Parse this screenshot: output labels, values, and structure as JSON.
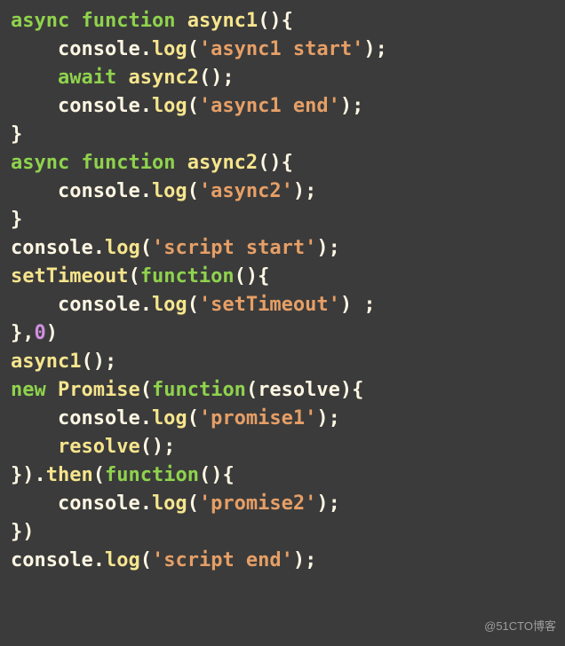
{
  "code": {
    "lines": [
      [
        {
          "cls": "tok-kw",
          "t": "async"
        },
        {
          "cls": "tok-punct",
          "t": " "
        },
        {
          "cls": "tok-kw",
          "t": "function"
        },
        {
          "cls": "tok-punct",
          "t": " "
        },
        {
          "cls": "tok-fn",
          "t": "async1"
        },
        {
          "cls": "tok-punct",
          "t": "(){"
        }
      ],
      [
        {
          "cls": "indent",
          "t": ""
        },
        {
          "cls": "tok-ident",
          "t": "console"
        },
        {
          "cls": "tok-punct",
          "t": "."
        },
        {
          "cls": "tok-fn",
          "t": "log"
        },
        {
          "cls": "tok-punct",
          "t": "("
        },
        {
          "cls": "tok-str",
          "t": "'async1 start'"
        },
        {
          "cls": "tok-punct",
          "t": ");"
        }
      ],
      [
        {
          "cls": "indent",
          "t": ""
        },
        {
          "cls": "tok-kw",
          "t": "await"
        },
        {
          "cls": "tok-punct",
          "t": " "
        },
        {
          "cls": "tok-fn",
          "t": "async2"
        },
        {
          "cls": "tok-punct",
          "t": "();"
        }
      ],
      [
        {
          "cls": "indent",
          "t": ""
        },
        {
          "cls": "tok-ident",
          "t": "console"
        },
        {
          "cls": "tok-punct",
          "t": "."
        },
        {
          "cls": "tok-fn",
          "t": "log"
        },
        {
          "cls": "tok-punct",
          "t": "("
        },
        {
          "cls": "tok-str",
          "t": "'async1 end'"
        },
        {
          "cls": "tok-punct",
          "t": ");"
        }
      ],
      [
        {
          "cls": "tok-punct",
          "t": "}"
        }
      ],
      [
        {
          "cls": "tok-kw",
          "t": "async"
        },
        {
          "cls": "tok-punct",
          "t": " "
        },
        {
          "cls": "tok-kw",
          "t": "function"
        },
        {
          "cls": "tok-punct",
          "t": " "
        },
        {
          "cls": "tok-fn",
          "t": "async2"
        },
        {
          "cls": "tok-punct",
          "t": "(){"
        }
      ],
      [
        {
          "cls": "indent",
          "t": ""
        },
        {
          "cls": "tok-ident",
          "t": "console"
        },
        {
          "cls": "tok-punct",
          "t": "."
        },
        {
          "cls": "tok-fn",
          "t": "log"
        },
        {
          "cls": "tok-punct",
          "t": "("
        },
        {
          "cls": "tok-str",
          "t": "'async2'"
        },
        {
          "cls": "tok-punct",
          "t": ");"
        }
      ],
      [
        {
          "cls": "tok-punct",
          "t": "}"
        }
      ],
      [
        {
          "cls": "tok-ident",
          "t": "console"
        },
        {
          "cls": "tok-punct",
          "t": "."
        },
        {
          "cls": "tok-fn",
          "t": "log"
        },
        {
          "cls": "tok-punct",
          "t": "("
        },
        {
          "cls": "tok-str",
          "t": "'script start'"
        },
        {
          "cls": "tok-punct",
          "t": ");"
        }
      ],
      [
        {
          "cls": "tok-fn",
          "t": "setTimeout"
        },
        {
          "cls": "tok-punct",
          "t": "("
        },
        {
          "cls": "tok-kw",
          "t": "function"
        },
        {
          "cls": "tok-punct",
          "t": "(){"
        }
      ],
      [
        {
          "cls": "indent",
          "t": ""
        },
        {
          "cls": "tok-ident",
          "t": "console"
        },
        {
          "cls": "tok-punct",
          "t": "."
        },
        {
          "cls": "tok-fn",
          "t": "log"
        },
        {
          "cls": "tok-punct",
          "t": "("
        },
        {
          "cls": "tok-str",
          "t": "'setTimeout'"
        },
        {
          "cls": "tok-punct",
          "t": ") ;"
        }
      ],
      [
        {
          "cls": "tok-punct",
          "t": "},"
        },
        {
          "cls": "tok-num",
          "t": "0"
        },
        {
          "cls": "tok-punct",
          "t": ")"
        }
      ],
      [
        {
          "cls": "tok-fn",
          "t": "async1"
        },
        {
          "cls": "tok-punct",
          "t": "();"
        }
      ],
      [
        {
          "cls": "tok-kw",
          "t": "new"
        },
        {
          "cls": "tok-punct",
          "t": " "
        },
        {
          "cls": "tok-fn",
          "t": "Promise"
        },
        {
          "cls": "tok-punct",
          "t": "("
        },
        {
          "cls": "tok-kw",
          "t": "function"
        },
        {
          "cls": "tok-punct",
          "t": "("
        },
        {
          "cls": "tok-ident",
          "t": "resolve"
        },
        {
          "cls": "tok-punct",
          "t": "){"
        }
      ],
      [
        {
          "cls": "indent",
          "t": ""
        },
        {
          "cls": "tok-ident",
          "t": "console"
        },
        {
          "cls": "tok-punct",
          "t": "."
        },
        {
          "cls": "tok-fn",
          "t": "log"
        },
        {
          "cls": "tok-punct",
          "t": "("
        },
        {
          "cls": "tok-str",
          "t": "'promise1'"
        },
        {
          "cls": "tok-punct",
          "t": ");"
        }
      ],
      [
        {
          "cls": "indent",
          "t": ""
        },
        {
          "cls": "tok-fn",
          "t": "resolve"
        },
        {
          "cls": "tok-punct",
          "t": "();"
        }
      ],
      [
        {
          "cls": "tok-punct",
          "t": "})."
        },
        {
          "cls": "tok-fn",
          "t": "then"
        },
        {
          "cls": "tok-punct",
          "t": "("
        },
        {
          "cls": "tok-kw",
          "t": "function"
        },
        {
          "cls": "tok-punct",
          "t": "(){"
        }
      ],
      [
        {
          "cls": "indent",
          "t": ""
        },
        {
          "cls": "tok-ident",
          "t": "console"
        },
        {
          "cls": "tok-punct",
          "t": "."
        },
        {
          "cls": "tok-fn",
          "t": "log"
        },
        {
          "cls": "tok-punct",
          "t": "("
        },
        {
          "cls": "tok-str",
          "t": "'promise2'"
        },
        {
          "cls": "tok-punct",
          "t": ");"
        }
      ],
      [
        {
          "cls": "tok-punct",
          "t": "})"
        }
      ],
      [
        {
          "cls": "tok-ident",
          "t": "console"
        },
        {
          "cls": "tok-punct",
          "t": "."
        },
        {
          "cls": "tok-fn",
          "t": "log"
        },
        {
          "cls": "tok-punct",
          "t": "("
        },
        {
          "cls": "tok-str",
          "t": "'script end'"
        },
        {
          "cls": "tok-punct",
          "t": ");"
        }
      ]
    ]
  },
  "watermark": "@51CTO博客"
}
